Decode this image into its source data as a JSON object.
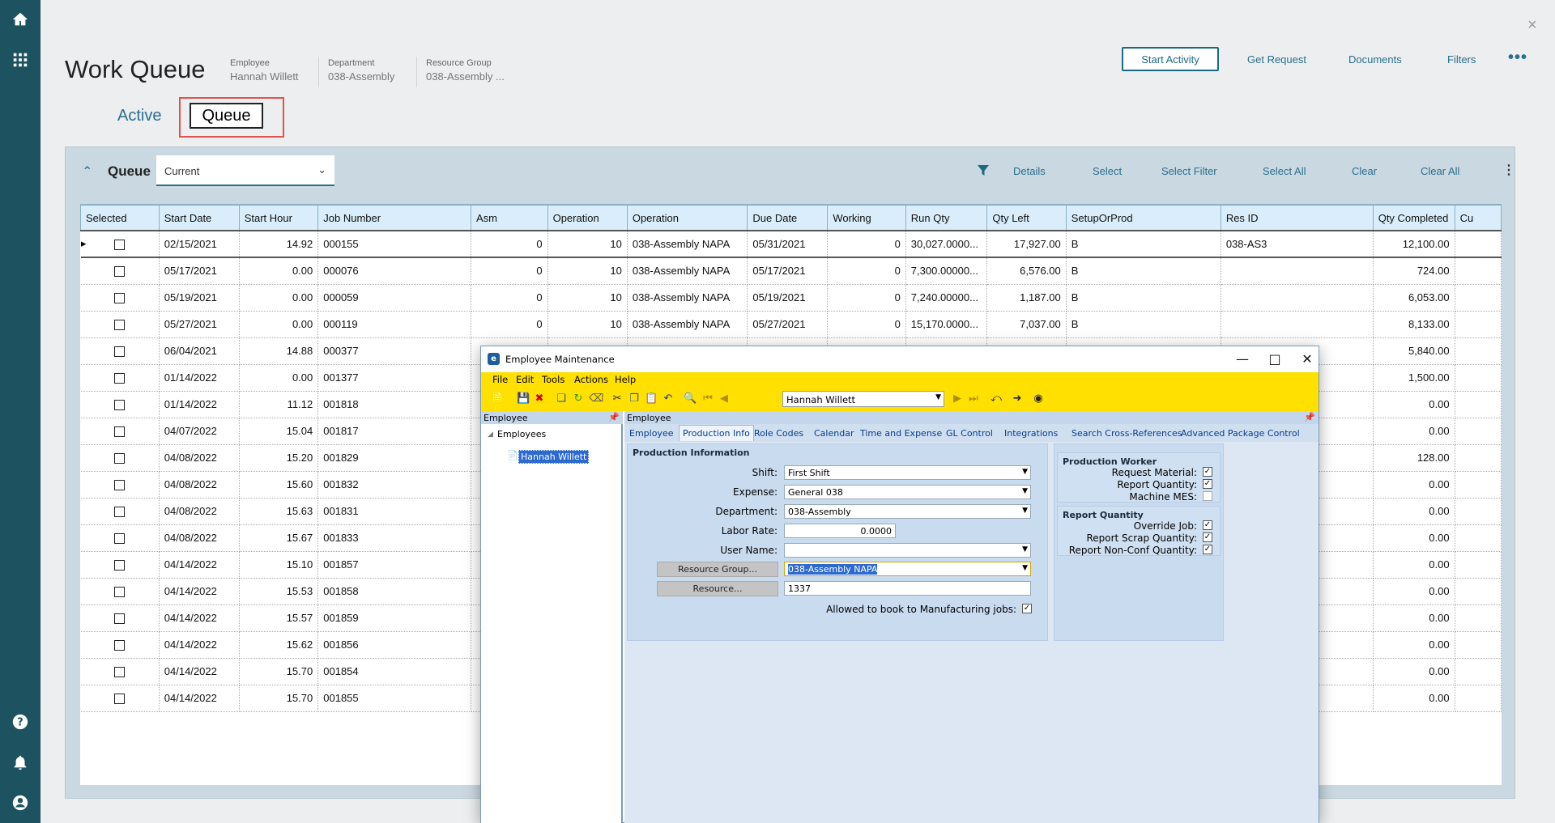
{
  "rail": {
    "icons": [
      "home-icon",
      "apps-grid-icon",
      "help-icon",
      "bell-icon",
      "user-icon"
    ]
  },
  "header": {
    "title": "Work Queue",
    "employee_label": "Employee",
    "employee_value": "Hannah Willett",
    "department_label": "Department",
    "department_value": "038-Assembly",
    "resource_group_label": "Resource Group",
    "resource_group_value": "038-Assembly ...",
    "start_activity": "Start Activity",
    "get_request": "Get Request",
    "documents": "Documents",
    "filters": "Filters",
    "more": "•••",
    "close": "×"
  },
  "tabs": {
    "active": "Active",
    "queue": "Queue"
  },
  "panel": {
    "title": "Queue",
    "filter_value": "Current",
    "actions": [
      "Details",
      "Select",
      "Select Filter",
      "Select All",
      "Clear",
      "Clear All"
    ],
    "more": "⋮"
  },
  "grid": {
    "columns": [
      "Selected",
      "Start Date",
      "Start Hour",
      "Job Number",
      "Asm",
      "Operation",
      "Operation",
      "Due Date",
      "Working",
      "Run Qty",
      "Qty Left",
      "SetupOrProd",
      "Res ID",
      "Qty Completed",
      "Cu"
    ],
    "rows": [
      {
        "start_date": "02/15/2021",
        "start_hour": "14.92",
        "job": "000155",
        "asm": "0",
        "op": "10",
        "op_desc": "038-Assembly NAPA",
        "due": "05/31/2021",
        "working": "0",
        "run_qty": "30,027.0000...",
        "qty_left": "17,927.00",
        "setup": "B",
        "res": "038-AS3",
        "qty_done": "12,100.00"
      },
      {
        "start_date": "05/17/2021",
        "start_hour": "0.00",
        "job": "000076",
        "asm": "0",
        "op": "10",
        "op_desc": "038-Assembly NAPA",
        "due": "05/17/2021",
        "working": "0",
        "run_qty": "7,300.00000...",
        "qty_left": "6,576.00",
        "setup": "B",
        "res": "",
        "qty_done": "724.00"
      },
      {
        "start_date": "05/19/2021",
        "start_hour": "0.00",
        "job": "000059",
        "asm": "0",
        "op": "10",
        "op_desc": "038-Assembly NAPA",
        "due": "05/19/2021",
        "working": "0",
        "run_qty": "7,240.00000...",
        "qty_left": "1,187.00",
        "setup": "B",
        "res": "",
        "qty_done": "6,053.00"
      },
      {
        "start_date": "05/27/2021",
        "start_hour": "0.00",
        "job": "000119",
        "asm": "0",
        "op": "10",
        "op_desc": "038-Assembly NAPA",
        "due": "05/27/2021",
        "working": "0",
        "run_qty": "15,170.0000...",
        "qty_left": "7,037.00",
        "setup": "B",
        "res": "",
        "qty_done": "8,133.00"
      },
      {
        "start_date": "06/04/2021",
        "start_hour": "14.88",
        "job": "000377",
        "asm": "",
        "op": "",
        "op_desc": "",
        "due": "",
        "working": "",
        "run_qty": "",
        "qty_left": "",
        "setup": "",
        "res": "",
        "qty_done": "5,840.00"
      },
      {
        "start_date": "01/14/2022",
        "start_hour": "0.00",
        "job": "001377",
        "asm": "",
        "op": "",
        "op_desc": "",
        "due": "",
        "working": "",
        "run_qty": "",
        "qty_left": "",
        "setup": "",
        "res": "",
        "qty_done": "1,500.00"
      },
      {
        "start_date": "01/14/2022",
        "start_hour": "11.12",
        "job": "001818",
        "asm": "",
        "op": "",
        "op_desc": "",
        "due": "",
        "working": "",
        "run_qty": "",
        "qty_left": "",
        "setup": "",
        "res": "",
        "qty_done": "0.00"
      },
      {
        "start_date": "04/07/2022",
        "start_hour": "15.04",
        "job": "001817",
        "asm": "",
        "op": "",
        "op_desc": "",
        "due": "",
        "working": "",
        "run_qty": "",
        "qty_left": "",
        "setup": "",
        "res": "",
        "qty_done": "0.00"
      },
      {
        "start_date": "04/08/2022",
        "start_hour": "15.20",
        "job": "001829",
        "asm": "",
        "op": "",
        "op_desc": "",
        "due": "",
        "working": "",
        "run_qty": "",
        "qty_left": "",
        "setup": "",
        "res": "",
        "qty_done": "128.00"
      },
      {
        "start_date": "04/08/2022",
        "start_hour": "15.60",
        "job": "001832",
        "asm": "",
        "op": "",
        "op_desc": "",
        "due": "",
        "working": "",
        "run_qty": "",
        "qty_left": "",
        "setup": "",
        "res": "",
        "qty_done": "0.00"
      },
      {
        "start_date": "04/08/2022",
        "start_hour": "15.63",
        "job": "001831",
        "asm": "",
        "op": "",
        "op_desc": "",
        "due": "",
        "working": "",
        "run_qty": "",
        "qty_left": "",
        "setup": "",
        "res": "",
        "qty_done": "0.00"
      },
      {
        "start_date": "04/08/2022",
        "start_hour": "15.67",
        "job": "001833",
        "asm": "",
        "op": "",
        "op_desc": "",
        "due": "",
        "working": "",
        "run_qty": "",
        "qty_left": "",
        "setup": "",
        "res": "",
        "qty_done": "0.00"
      },
      {
        "start_date": "04/14/2022",
        "start_hour": "15.10",
        "job": "001857",
        "asm": "",
        "op": "",
        "op_desc": "",
        "due": "",
        "working": "",
        "run_qty": "",
        "qty_left": "",
        "setup": "",
        "res": "",
        "qty_done": "0.00"
      },
      {
        "start_date": "04/14/2022",
        "start_hour": "15.53",
        "job": "001858",
        "asm": "",
        "op": "",
        "op_desc": "",
        "due": "",
        "working": "",
        "run_qty": "",
        "qty_left": "",
        "setup": "",
        "res": "",
        "qty_done": "0.00"
      },
      {
        "start_date": "04/14/2022",
        "start_hour": "15.57",
        "job": "001859",
        "asm": "",
        "op": "",
        "op_desc": "",
        "due": "",
        "working": "",
        "run_qty": "",
        "qty_left": "",
        "setup": "",
        "res": "",
        "qty_done": "0.00"
      },
      {
        "start_date": "04/14/2022",
        "start_hour": "15.62",
        "job": "001856",
        "asm": "",
        "op": "",
        "op_desc": "",
        "due": "",
        "working": "",
        "run_qty": "",
        "qty_left": "",
        "setup": "",
        "res": "",
        "qty_done": "0.00"
      },
      {
        "start_date": "04/14/2022",
        "start_hour": "15.70",
        "job": "001854",
        "asm": "",
        "op": "",
        "op_desc": "",
        "due": "",
        "working": "",
        "run_qty": "",
        "qty_left": "",
        "setup": "",
        "res": "",
        "qty_done": "0.00"
      },
      {
        "start_date": "04/14/2022",
        "start_hour": "15.70",
        "job": "001855",
        "asm": "",
        "op": "",
        "op_desc": "",
        "due": "",
        "working": "",
        "run_qty": "",
        "qty_left": "",
        "setup": "",
        "res": "",
        "qty_done": "0.00"
      }
    ]
  },
  "emw": {
    "title": "Employee Maintenance",
    "menu": [
      "File",
      "Edit",
      "Tools",
      "Actions",
      "Help"
    ],
    "combo_value": "Hannah Willett",
    "left_header": "Employee",
    "right_header": "Employee",
    "tree_root": "Employees",
    "tree_selected": "Hannah Willett",
    "tabs": [
      "Employee",
      "Production Info",
      "Role Codes",
      "Calendar",
      "Time and Expense",
      "GL Control",
      "Integrations",
      "Search Cross-References",
      "Advanced Package Control"
    ],
    "prod_info_title": "Production Information",
    "shift_label": "Shift:",
    "shift_value": "First Shift",
    "expense_label": "Expense:",
    "expense_value": "General 038",
    "department_label": "Department:",
    "department_value": "038-Assembly",
    "labor_rate_label": "Labor Rate:",
    "labor_rate_value": "0.0000",
    "user_name_label": "User Name:",
    "user_name_value": "",
    "resource_group_btn": "Resource Group...",
    "resource_group_value": "038-Assembly NAPA",
    "resource_btn": "Resource...",
    "resource_value": "1337",
    "allowed_label": "Allowed to book to Manufacturing jobs:",
    "prod_worker_title": "Production Worker",
    "request_material": "Request Material:",
    "report_quantity": "Report Quantity:",
    "machine_mes": "Machine MES:",
    "report_qty_title": "Report Quantity",
    "override_job": "Override Job:",
    "report_scrap": "Report Scrap Quantity:",
    "report_nonconf": "Report Non-Conf Quantity:",
    "checks": {
      "allowed": true,
      "request_material": true,
      "report_quantity": true,
      "machine_mes": false,
      "override_job": true,
      "report_scrap": true,
      "report_nonconf": true
    }
  }
}
